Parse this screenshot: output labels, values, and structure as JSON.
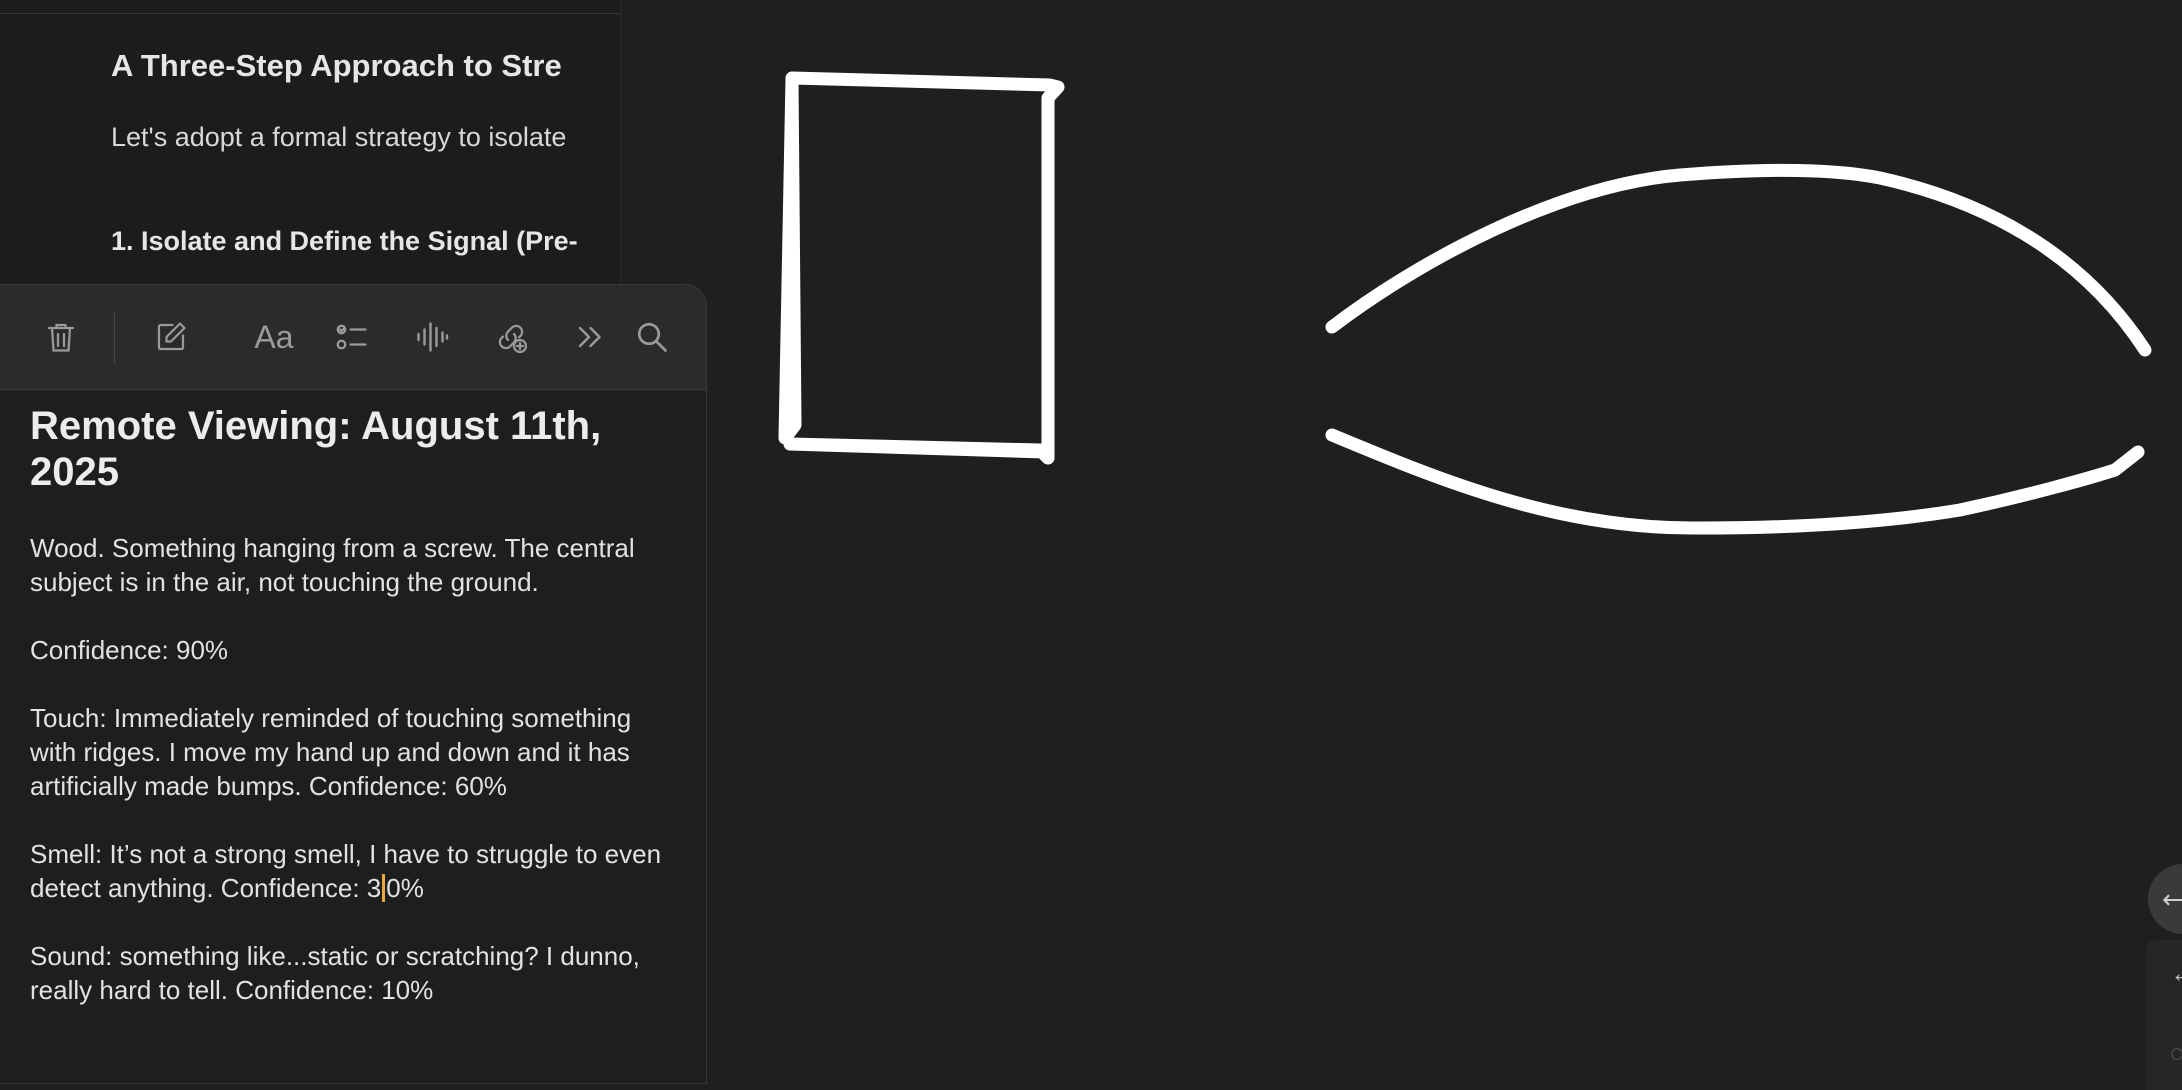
{
  "background_doc": {
    "heading": "A Three-Step Approach to Stre",
    "paragraph": "Let's adopt a formal strategy to isolate",
    "subheading": "1. Isolate and Define the Signal (Pre-"
  },
  "toolbar": {
    "icons": [
      "trash-icon",
      "compose-icon",
      "format-text-icon",
      "checklist-icon",
      "audio-icon",
      "share-collab-icon",
      "more-icon",
      "search-icon"
    ],
    "format_label": "Aa"
  },
  "note": {
    "title": "Remote Viewing: August 11th, 2025",
    "p1": "Wood. Something hanging from a screw. The central subject is in the air, not touching the ground.",
    "p2": "Confidence: 90%",
    "p3": "Touch: Immediately reminded of touching something with ridges. I move my hand up and down and it has artificially made bumps. Confidence: 60%",
    "p4_before_cursor": "Smell: It’s not a strong smell, I have to struggle to even detect anything. Confidence: 3",
    "p4_after_cursor": "0%",
    "p5": "Sound: something like...static or scratching? I dunno, really hard to tell. Confidence: 10%"
  },
  "colors": {
    "canvas": "#1f1f1f",
    "ink": "#ffffff",
    "cursor": "#e8a93a"
  }
}
